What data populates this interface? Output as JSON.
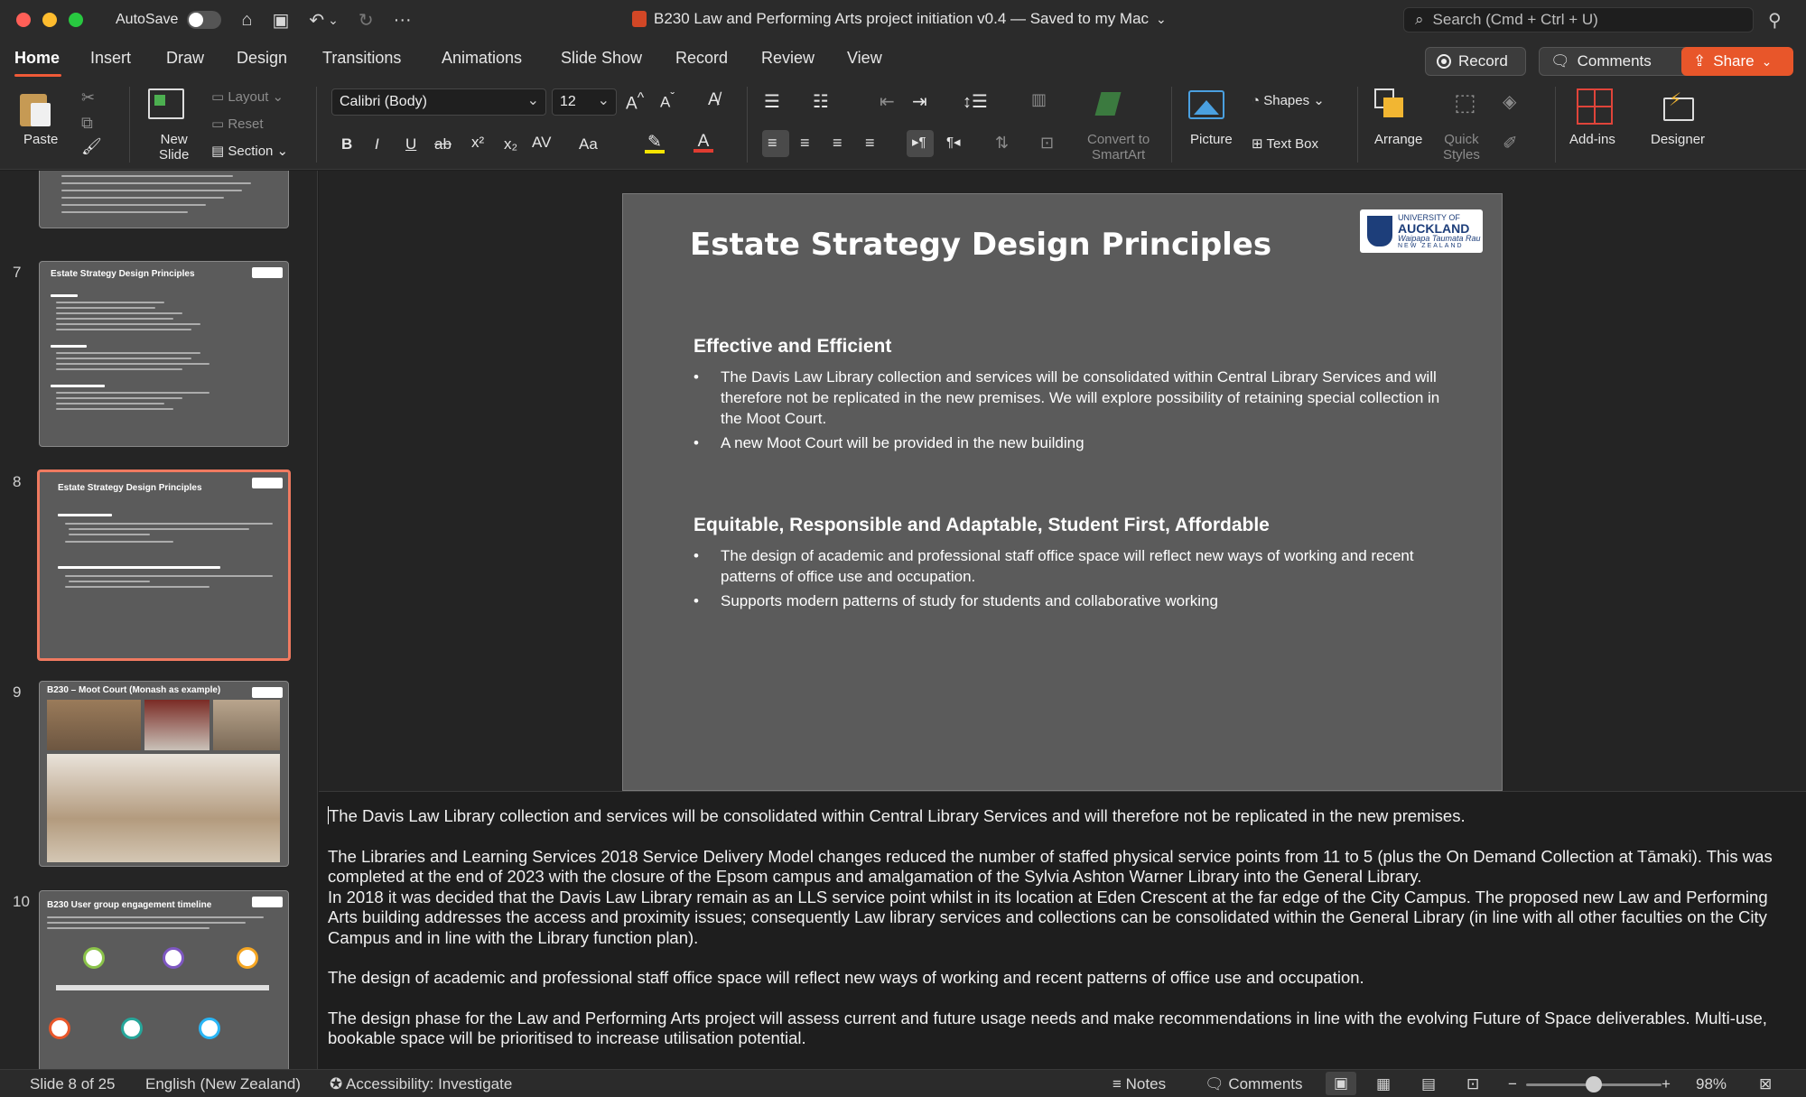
{
  "titlebar": {
    "autosave_label": "AutoSave",
    "doc_title": "B230 Law and Performing Arts project initiation v0.4 — Saved to my Mac",
    "search_placeholder": "Search (Cmd + Ctrl + U)"
  },
  "menu": {
    "tabs": [
      "Home",
      "Insert",
      "Draw",
      "Design",
      "Transitions",
      "Animations",
      "Slide Show",
      "Record",
      "Review",
      "View"
    ],
    "record_label": "Record",
    "comments_label": "Comments",
    "share_label": "Share"
  },
  "ribbon": {
    "paste": "Paste",
    "new_slide": [
      "New",
      "Slide"
    ],
    "layout": "Layout",
    "reset": "Reset",
    "section": "Section",
    "font_name": "Calibri (Body)",
    "font_size": "12",
    "convert_smartart": [
      "Convert to",
      "SmartArt"
    ],
    "picture": "Picture",
    "shapes": "Shapes",
    "text_box": "Text Box",
    "arrange": "Arrange",
    "quick_styles": [
      "Quick",
      "Styles"
    ],
    "add_ins": "Add-ins",
    "designer": "Designer",
    "format_buttons": [
      "B",
      "I",
      "U",
      "ab",
      "x²",
      "x₂",
      "AV",
      "Aa"
    ]
  },
  "thumbnails": [
    {
      "num": "7",
      "title": "Estate Strategy Design Principles"
    },
    {
      "num": "8",
      "title": "Estate Strategy Design Principles"
    },
    {
      "num": "9",
      "title": "B230 – Moot Court (Monash as example)"
    },
    {
      "num": "10",
      "title": "B230 User group engagement timeline"
    }
  ],
  "slide": {
    "title": "Estate Strategy Design Principles",
    "logo_lines": [
      "UNIVERSITY OF",
      "AUCKLAND",
      "Waipapa Taumata Rau",
      "NEW ZEALAND"
    ],
    "sections": [
      {
        "heading": "Effective and Efficient",
        "bullets": [
          "The Davis Law Library collection and services will be consolidated within Central Library Services and will therefore not be replicated in the new premises. We will explore possibility of retaining special collection in the Moot Court.",
          "A new Moot Court will be provided in the new building"
        ]
      },
      {
        "heading": "Equitable, Responsible and Adaptable, Student First, Affordable",
        "bullets": [
          "The design of academic and professional staff office space will reflect new ways of working and recent patterns of office use and occupation.",
          "Supports modern patterns of study for students and collaborative working"
        ]
      }
    ]
  },
  "notes": {
    "p1": "The Davis Law Library collection and services will be consolidated within Central Library Services and will therefore not be replicated in the new premises.",
    "p2": "The Libraries and Learning Services 2018 Service Delivery Model changes reduced the number of staffed physical service points from 11 to 5 (plus the On Demand Collection at Tāmaki). This was completed at the end of 2023 with the closure of the Epsom campus and amalgamation of the Sylvia Ashton Warner Library into the General Library.",
    "p3": "In 2018 it was decided that the Davis Law Library remain as an LLS service point whilst in its location at Eden Crescent at the far edge of the City Campus. The proposed new Law and Performing Arts building addresses the access and proximity issues; consequently Law library services and collections can be consolidated within the General Library (in line with all other faculties on the City Campus and in line with the Library function plan).",
    "p4": "The design of academic and professional staff office space will reflect new ways of working and recent patterns of office use and occupation.",
    "p5": "The design phase for the Law and Performing Arts project will assess current and future usage needs and make recommendations in line with the evolving Future of Space deliverables. Multi-use, bookable space will be prioritised to increase utilisation potential."
  },
  "status": {
    "slide_pos": "Slide 8 of 25",
    "language": "English (New Zealand)",
    "accessibility": "Accessibility: Investigate",
    "notes": "Notes",
    "comments": "Comments",
    "zoom": "98%",
    "zoom_fraction": 0.5
  },
  "colors": {
    "accent": "#f05a38",
    "share": "#e8562a",
    "slide_bg": "#5b5b5b"
  }
}
